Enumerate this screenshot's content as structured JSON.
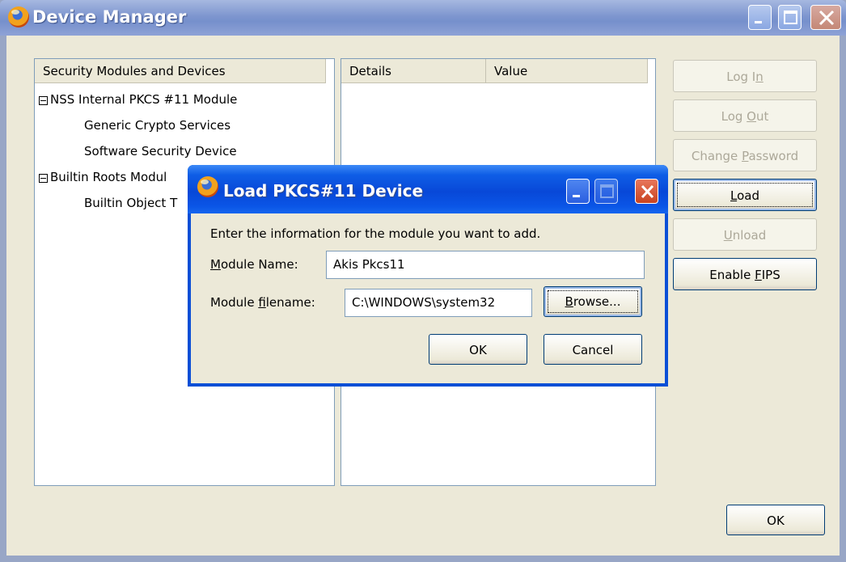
{
  "main_window": {
    "title": "Device Manager",
    "modules_pane": {
      "header": "Security Modules and Devices",
      "items": [
        {
          "label": "NSS Internal PKCS #11 Module",
          "expanded": true
        },
        {
          "label": "Generic Crypto Services"
        },
        {
          "label": "Software Security Device"
        },
        {
          "label": "Builtin Roots Modul"
        },
        {
          "label": "Builtin Object T"
        }
      ]
    },
    "details_pane": {
      "headers": [
        "Details",
        "Value"
      ]
    },
    "buttons": {
      "log_in": {
        "pre": "Log I",
        "key": "n",
        "post": ""
      },
      "log_out": {
        "pre": "Log ",
        "key": "O",
        "post": "ut"
      },
      "change_password": {
        "pre": "Change ",
        "key": "P",
        "post": "assword"
      },
      "load": {
        "pre": "",
        "key": "L",
        "post": "oad"
      },
      "unload": {
        "pre": "",
        "key": "U",
        "post": "nload"
      },
      "enable_fips": {
        "pre": "Enable ",
        "key": "F",
        "post": "IPS"
      },
      "ok": "OK"
    }
  },
  "dialog": {
    "title": "Load PKCS#11 Device",
    "instruction": "Enter the information for the module you want to add.",
    "module_name": {
      "pre": "",
      "key": "M",
      "post": "odule Name:",
      "value": "Akis Pkcs11"
    },
    "module_filename": {
      "pre": "Module ",
      "key": "f",
      "post": "ilename:",
      "value": "C:\\WINDOWS\\system32"
    },
    "browse": {
      "pre": "",
      "key": "B",
      "post": "rowse..."
    },
    "ok": "OK",
    "cancel": "Cancel"
  },
  "colors": {
    "window_face": "#ece9d8",
    "dialog_title_blue": "#0848d8",
    "disabled_text": "#aca899"
  },
  "icons": [
    "firefox-app-icon",
    "minimize-icon",
    "maximize-icon",
    "close-icon",
    "collapse-icon"
  ]
}
